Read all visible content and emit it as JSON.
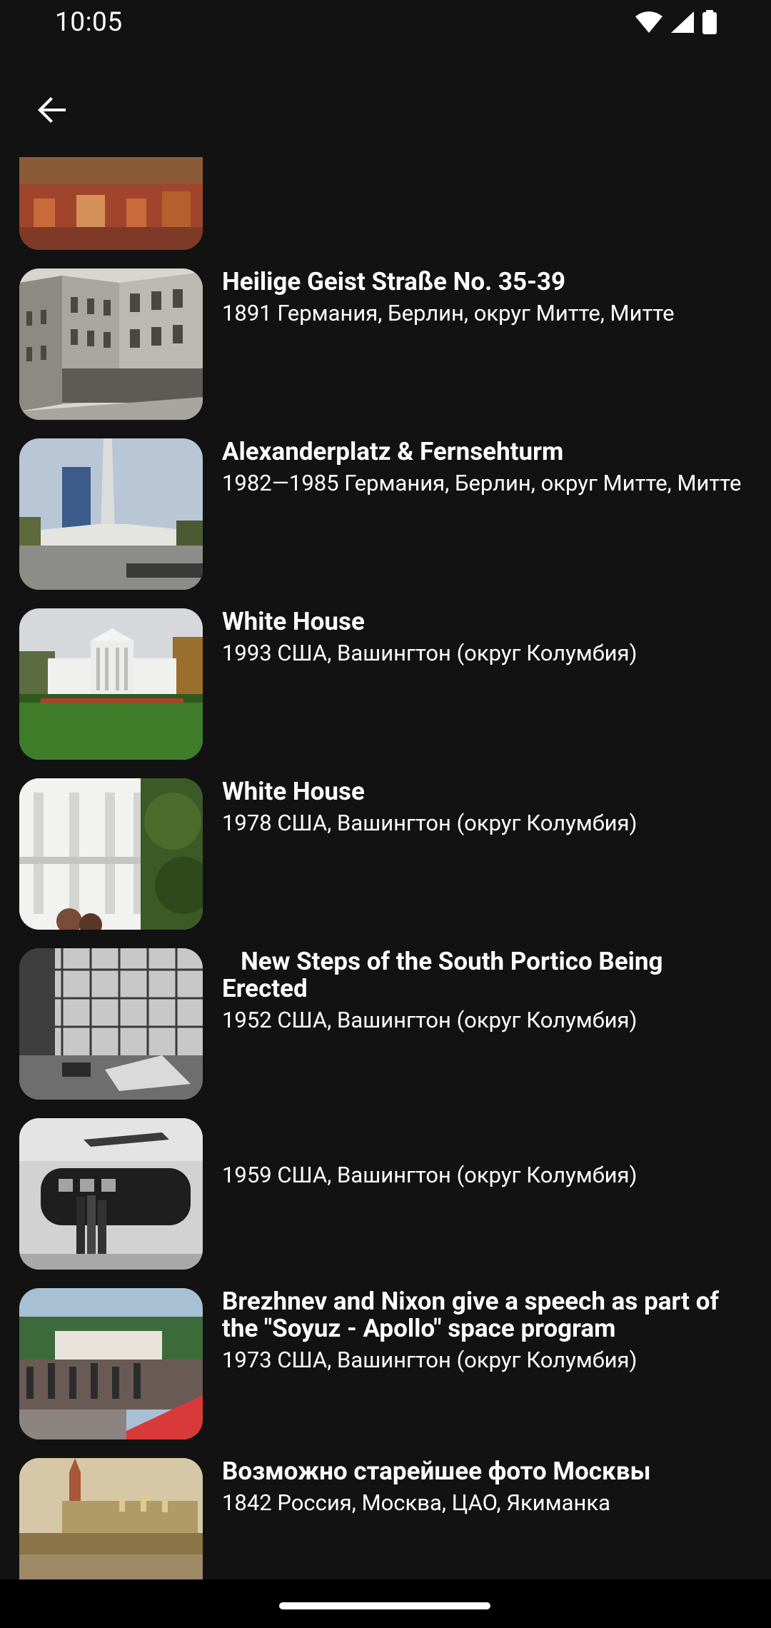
{
  "status_bar": {
    "time": "10:05"
  },
  "app_bar": {
    "back_icon": "arrow-back-icon"
  },
  "items": [
    {
      "title": "",
      "subtitle": "",
      "thumb": "street-scene"
    },
    {
      "title": "Heilige Geist Straße No. 35-39",
      "subtitle": "1891 Германия, Берлин, округ Митте, Митте",
      "thumb": "old-street"
    },
    {
      "title": "Alexanderplatz & Fernsehturm",
      "subtitle": "1982—1985 Германия, Берлин, округ Митте, Митте",
      "thumb": "tv-tower"
    },
    {
      "title": "White House",
      "subtitle": "1993 США, Вашингтон (округ Колумбия)",
      "thumb": "white-house-lawn"
    },
    {
      "title": "White House",
      "subtitle": "1978 США, Вашингтон (округ Колумбия)",
      "thumb": "white-house-portico"
    },
    {
      "title": "   New Steps of the South Portico Being Erected",
      "subtitle": "1952 США, Вашингтон (округ Колумбия)",
      "thumb": "construction"
    },
    {
      "title": "",
      "subtitle": "1959 США, Вашингтон (округ Колумбия)",
      "thumb": "helicopter"
    },
    {
      "title": "Brezhnev and Nixon give a speech as part of the \"Soyuz - Apollo\" space program",
      "subtitle": "1973 США, Вашингтон (округ Колумбия)",
      "thumb": "crowd"
    },
    {
      "title": "Возможно старейшее фото Москвы",
      "subtitle": "1842 Россия, Москва, ЦАО, Якиманка",
      "thumb": "kremlin"
    }
  ]
}
